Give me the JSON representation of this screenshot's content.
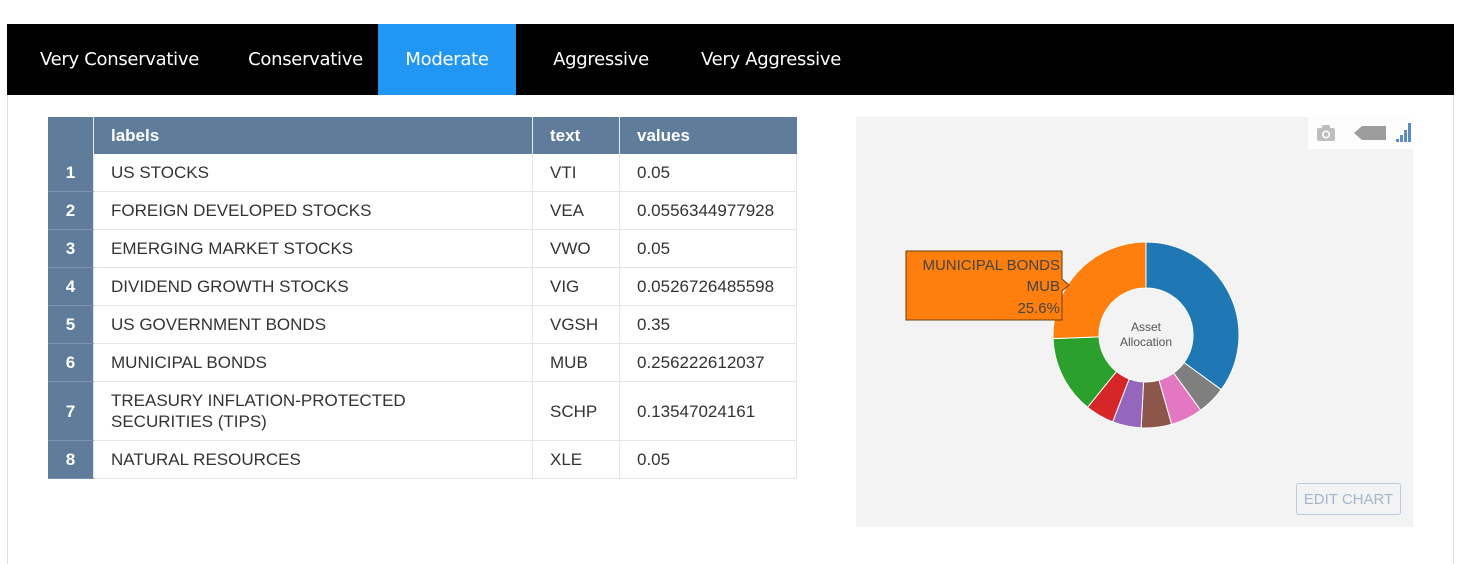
{
  "tabs": [
    {
      "label": "Very Conservative",
      "active": false
    },
    {
      "label": "Conservative",
      "active": false
    },
    {
      "label": "Moderate",
      "active": true
    },
    {
      "label": "Aggressive",
      "active": false
    },
    {
      "label": "Very Aggressive",
      "active": false
    }
  ],
  "table": {
    "headers": [
      "",
      "labels",
      "text",
      "values"
    ],
    "rows": [
      {
        "index": "1",
        "label": "US STOCKS",
        "text": "VTI",
        "value": "0.05"
      },
      {
        "index": "2",
        "label": "FOREIGN DEVELOPED STOCKS",
        "text": "VEA",
        "value": "0.0556344977928"
      },
      {
        "index": "3",
        "label": "EMERGING MARKET STOCKS",
        "text": "VWO",
        "value": "0.05"
      },
      {
        "index": "4",
        "label": "DIVIDEND GROWTH STOCKS",
        "text": "VIG",
        "value": "0.0526726485598"
      },
      {
        "index": "5",
        "label": "US GOVERNMENT BONDS",
        "text": "VGSH",
        "value": "0.35"
      },
      {
        "index": "6",
        "label": "MUNICIPAL BONDS",
        "text": "MUB",
        "value": "0.256222612037"
      },
      {
        "index": "7",
        "label": "TREASURY INFLATION-PROTECTED SECURITIES (TIPS)",
        "text": "SCHP",
        "value": "0.13547024161"
      },
      {
        "index": "8",
        "label": "NATURAL RESOURCES",
        "text": "XLE",
        "value": "0.05"
      }
    ]
  },
  "chart": {
    "center_label": [
      "Asset",
      "Allocation"
    ],
    "hover": {
      "line1": "MUNICIPAL BONDS",
      "line2": "MUB",
      "line3": "25.6%"
    },
    "edit_label": "EDIT CHART",
    "modebar_icons": [
      "camera-icon",
      "tag-icon",
      "plotly-logo-icon"
    ]
  },
  "chart_data": {
    "type": "pie",
    "hole": true,
    "slices": [
      {
        "label": "US GOVERNMENT BONDS",
        "value": 0.35,
        "color": "#1f77b4"
      },
      {
        "label": "US STOCKS",
        "value": 0.05,
        "color": "#7f7f7f"
      },
      {
        "label": "FOREIGN DEVELOPED STOCKS",
        "value": 0.0556344977928,
        "color": "#e377c2"
      },
      {
        "label": "DIVIDEND GROWTH STOCKS",
        "value": 0.0526726485598,
        "color": "#8c564b"
      },
      {
        "label": "EMERGING MARKET STOCKS",
        "value": 0.05,
        "color": "#9467bd"
      },
      {
        "label": "NATURAL RESOURCES",
        "value": 0.05,
        "color": "#d62728"
      },
      {
        "label": "TREASURY INFLATION-PROTECTED SECURITIES (TIPS)",
        "value": 0.13547024161,
        "color": "#2ca02c"
      },
      {
        "label": "MUNICIPAL BONDS",
        "value": 0.256222612037,
        "color": "#ff7f0e"
      }
    ]
  }
}
